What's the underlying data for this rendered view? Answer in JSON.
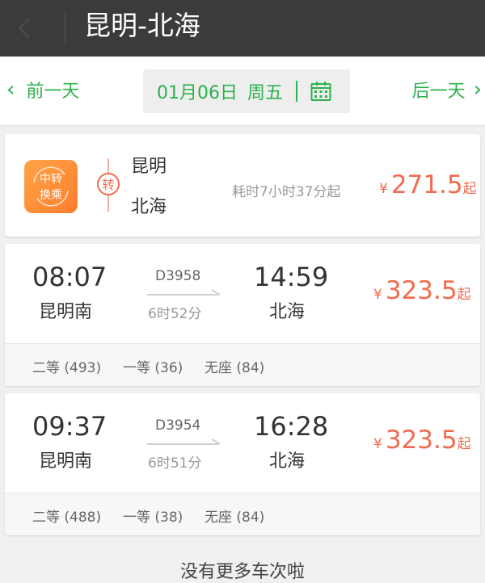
{
  "header": {
    "title": "昆明-北海"
  },
  "datebar": {
    "prev_label": "前一天",
    "next_label": "后一天",
    "date": "01月06日",
    "weekday": "周五"
  },
  "transfer": {
    "badge_line1": "中转",
    "badge_line2": "换乘",
    "transfer_mark": "转",
    "from": "昆明",
    "to": "北海",
    "duration": "耗时7小时37分起",
    "currency": "¥",
    "price": "271.5",
    "price_suffix": "起"
  },
  "trains": [
    {
      "dep_time": "08:07",
      "dep_station": "昆明南",
      "train_no": "D3958",
      "duration": "6时52分",
      "arr_time": "14:59",
      "arr_station": "北海",
      "currency": "¥",
      "price": "323.5",
      "price_suffix": "起",
      "seats": [
        "二等 (493)",
        "一等 (36)",
        "无座 (84)"
      ]
    },
    {
      "dep_time": "09:37",
      "dep_station": "昆明南",
      "train_no": "D3954",
      "duration": "6时51分",
      "arr_time": "16:28",
      "arr_station": "北海",
      "currency": "¥",
      "price": "323.5",
      "price_suffix": "起",
      "seats": [
        "二等 (488)",
        "一等 (38)",
        "无座 (84)"
      ]
    }
  ],
  "footer": {
    "text": "没有更多车次啦"
  },
  "colors": {
    "accent_green": "#2bb24c",
    "price_orange": "#f26b4f",
    "header_bg": "#3b3b3b"
  }
}
